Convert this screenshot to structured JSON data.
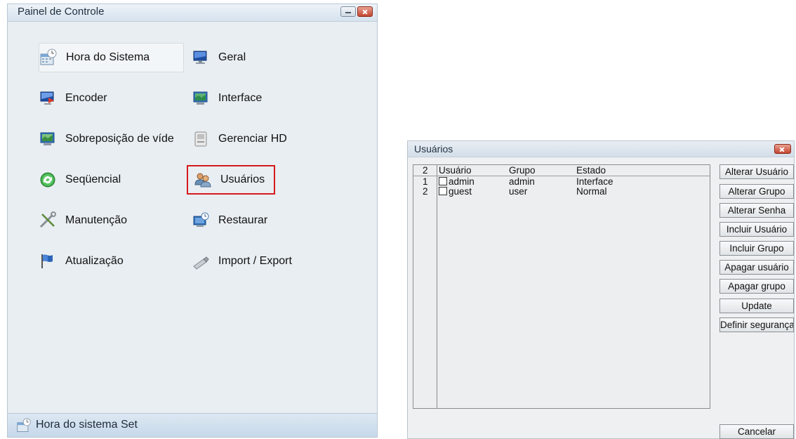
{
  "control_panel": {
    "title": "Painel de Controle",
    "items": [
      {
        "label": "Hora do Sistema",
        "icon": "clock-calendar-icon"
      },
      {
        "label": "Geral",
        "icon": "monitor-icon"
      },
      {
        "label": "Encoder",
        "icon": "encoder-monitor-icon"
      },
      {
        "label": "Interface",
        "icon": "interface-monitor-icon"
      },
      {
        "label": "Sobreposição de víde",
        "icon": "overlay-monitor-icon"
      },
      {
        "label": "Gerenciar HD",
        "icon": "hard-disk-icon"
      },
      {
        "label": "Seqüencial",
        "icon": "sequence-refresh-icon"
      },
      {
        "label": "Usuários",
        "icon": "users-icon"
      },
      {
        "label": "Manutenção",
        "icon": "tools-icon"
      },
      {
        "label": "Restaurar",
        "icon": "restore-computer-icon"
      },
      {
        "label": "Atualização",
        "icon": "flag-icon"
      },
      {
        "label": "Import / Export",
        "icon": "usb-stick-icon"
      }
    ],
    "status_text": "Hora do sistema Set",
    "highlight_color": "#d6191d"
  },
  "users_window": {
    "title": "Usuários",
    "table": {
      "count": "2",
      "headers": [
        "Usuário",
        "Grupo",
        "Estado"
      ],
      "rows": [
        {
          "index": "1",
          "user": "admin",
          "group": "admin",
          "state": "Interface"
        },
        {
          "index": "2",
          "user": "guest",
          "group": "user",
          "state": "Normal"
        }
      ]
    },
    "buttons": {
      "alterar_usuario": "Alterar Usuário",
      "alterar_grupo": "Alterar Grupo",
      "alterar_senha": "Alterar Senha",
      "incluir_usuario": "Incluir Usuário",
      "incluir_grupo": "Incluir Grupo",
      "apagar_usuario": "Apagar usuário",
      "apagar_grupo": "Apagar grupo",
      "update": "Update",
      "definir_seguranca": "Definir segurança",
      "cancelar": "Cancelar"
    }
  }
}
